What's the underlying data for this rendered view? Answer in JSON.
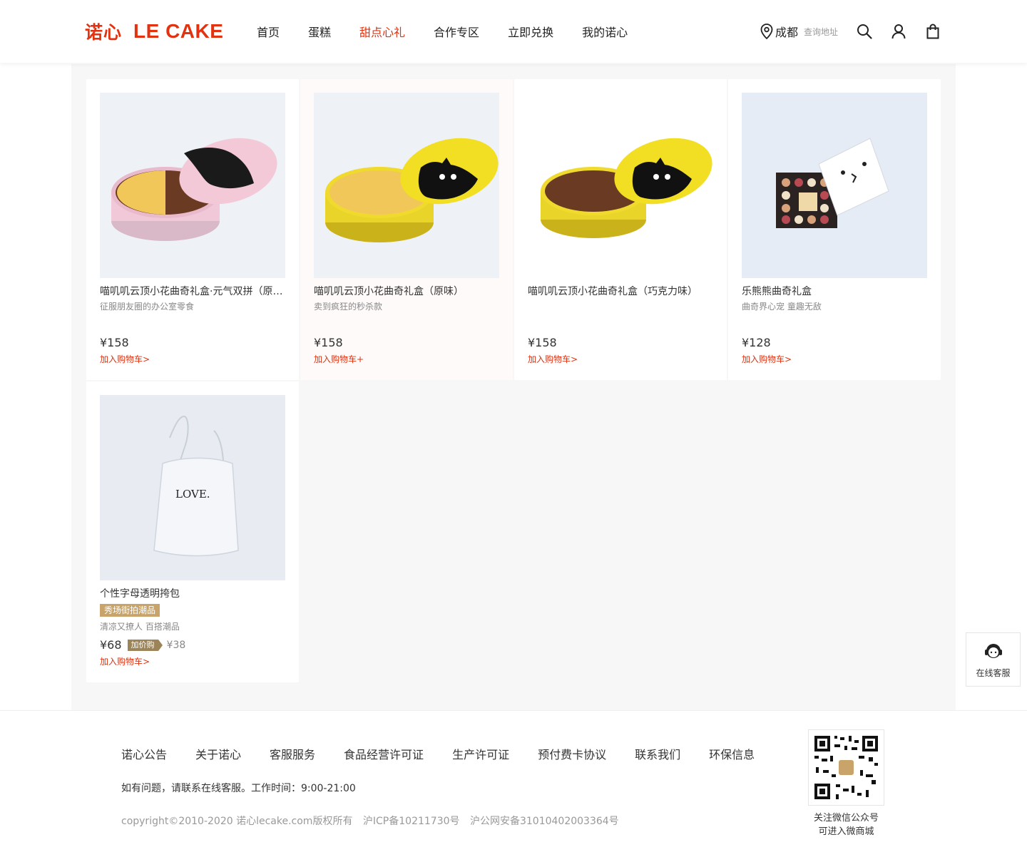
{
  "header": {
    "logo_cn": "诺心",
    "logo_en": "LE CAKE",
    "nav": [
      {
        "label": "首页",
        "active": false
      },
      {
        "label": "蛋糕",
        "active": false
      },
      {
        "label": "甜点心礼",
        "active": true
      },
      {
        "label": "合作专区",
        "active": false
      },
      {
        "label": "立即兑换",
        "active": false
      },
      {
        "label": "我的诺心",
        "active": false
      }
    ],
    "city": "成都",
    "address_link": "查询地址",
    "icons": [
      "location-icon",
      "search-icon",
      "user-icon",
      "bag-icon"
    ],
    "accent_color": "#e2320f"
  },
  "products": [
    {
      "name": "喵叽叽云顶小花曲奇礼盒·元气双拼（原味+巧克力味）",
      "desc": "征服朋友圈的办公室零食",
      "price": "¥158",
      "cart": "加入购物车>"
    },
    {
      "name": "喵叽叽云顶小花曲奇礼盒（原味）",
      "desc": "卖到疯狂的秒杀款",
      "price": "¥158",
      "cart": "加入购物车+"
    },
    {
      "name": "喵叽叽云顶小花曲奇礼盒（巧克力味）",
      "desc": "",
      "price": "¥158",
      "cart": "加入购物车>"
    },
    {
      "name": "乐熊熊曲奇礼盒",
      "desc": "曲奇界心宠 童趣无敌",
      "price": "¥128",
      "cart": "加入购物车>"
    },
    {
      "name": "个性字母透明挎包",
      "tag": "秀场街拍潮品",
      "desc": "清凉又撩人 百搭潮品",
      "price": "¥68",
      "addon_label": "加价购",
      "addon_price": "¥38",
      "cart": "加入购物车>",
      "image_text": "LOVE."
    }
  ],
  "service": {
    "label": "在线客服"
  },
  "footer": {
    "links": [
      "诺心公告",
      "关于诺心",
      "客服服务",
      "食品经营许可证",
      "生产许可证",
      "预付费卡协议",
      "联系我们",
      "环保信息"
    ],
    "contact": "如有问题，请联系在线客服。工作时间：9:00-21:00",
    "copyright": "copyright©2010-2020 诺心lecake.com版权所有",
    "icp": "沪ICP备10211730号",
    "police": "沪公网安备31010402003364号",
    "qr_caption_1": "关注微信公众号",
    "qr_caption_2": "可进入微商城"
  }
}
